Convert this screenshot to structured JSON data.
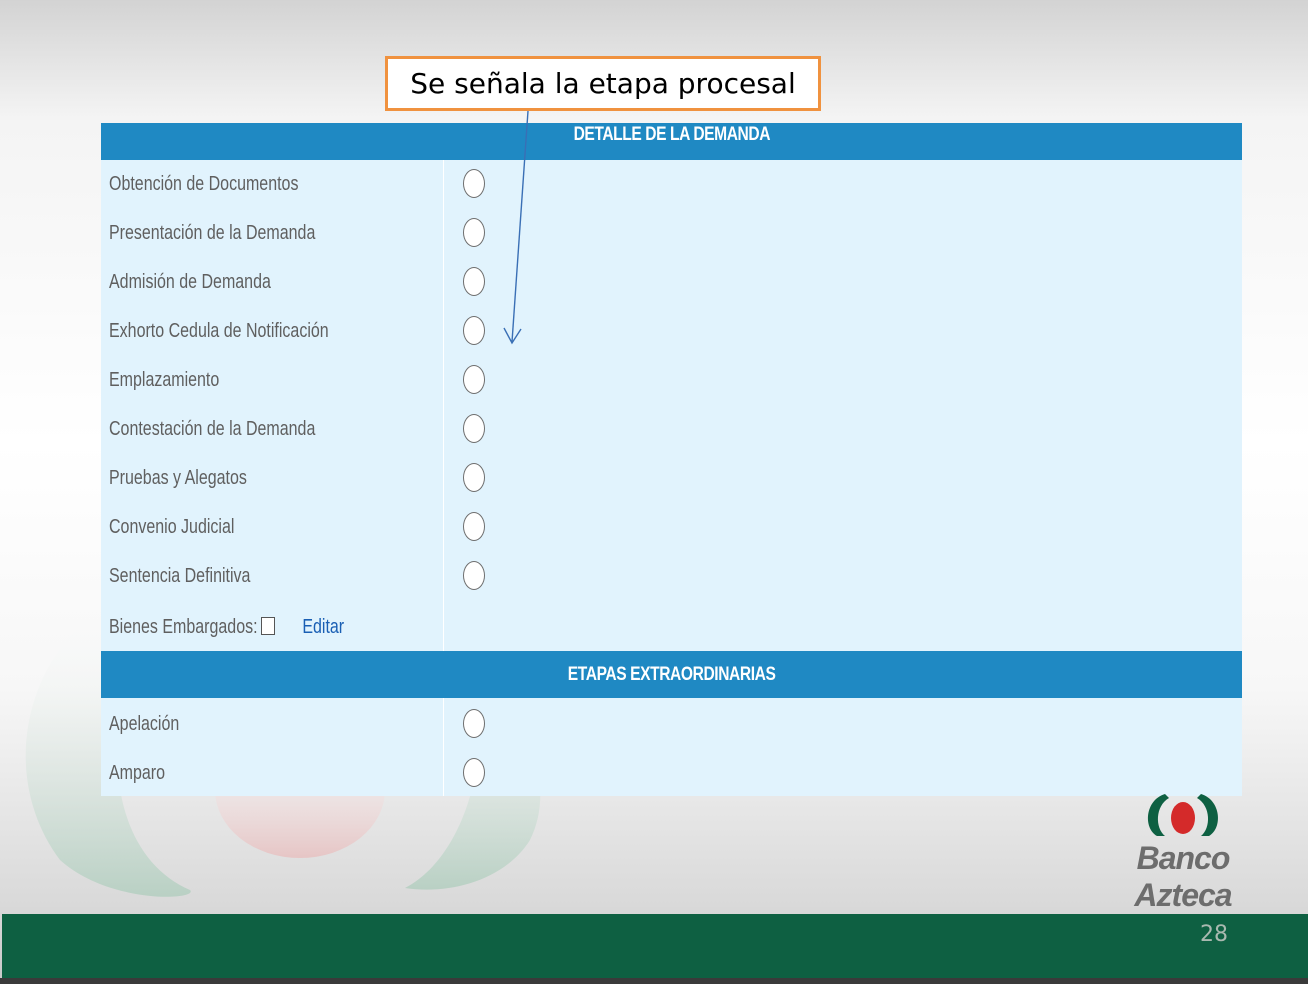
{
  "slide": {
    "callout_text": "Se señala la etapa procesal",
    "page_number": "28",
    "brand_name": "Banco Azteca",
    "brand_colors": {
      "green": "#0e6042",
      "red": "#d42a2a",
      "accent_orange": "#f0923f",
      "header_blue": "#1f89c3"
    }
  },
  "form": {
    "section_main_title": "DETALLE DE LA DEMANDA",
    "stages": [
      {
        "label": "Obtención de Documentos",
        "selected": false
      },
      {
        "label": "Presentación de la Demanda",
        "selected": false
      },
      {
        "label": "Admisión de Demanda",
        "selected": false
      },
      {
        "label": "Exhorto Cedula de Notificación",
        "selected": false
      },
      {
        "label": "Emplazamiento",
        "selected": false
      },
      {
        "label": "Contestación de la Demanda",
        "selected": false
      },
      {
        "label": "Pruebas y Alegatos",
        "selected": false
      },
      {
        "label": "Convenio Judicial",
        "selected": false
      },
      {
        "label": "Sentencia Definitiva",
        "selected": false
      }
    ],
    "bienes_label": "Bienes Embargados:",
    "bienes_checked": false,
    "edit_link": "Editar",
    "section_extra_title": "ETAPAS EXTRAORDINARIAS",
    "extra_stages": [
      {
        "label": "Apelación",
        "selected": false
      },
      {
        "label": "Amparo",
        "selected": false
      }
    ]
  }
}
